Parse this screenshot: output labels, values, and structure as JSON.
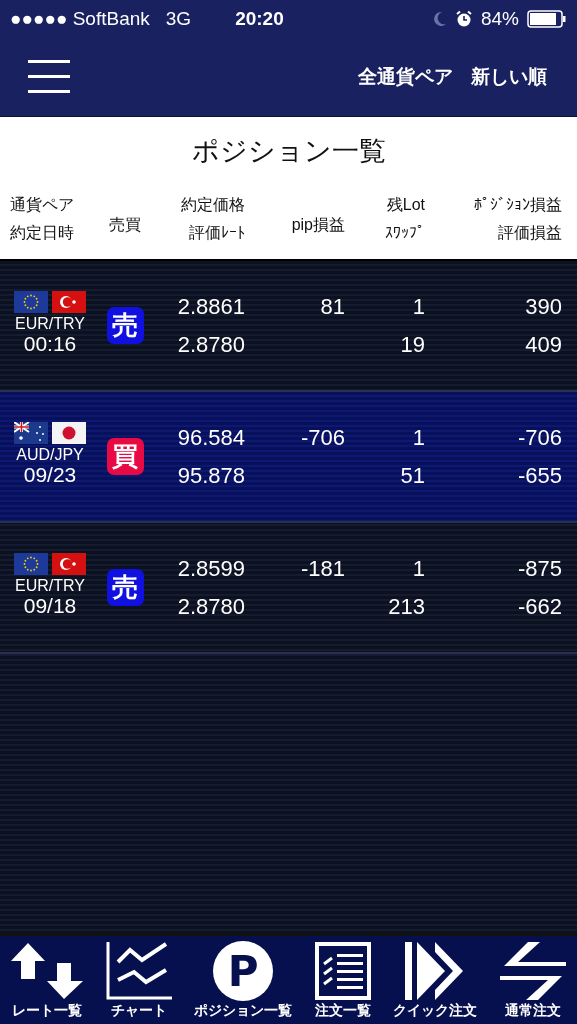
{
  "status_bar": {
    "carrier": "●●●●● SoftBank",
    "network": "3G",
    "time": "20:20",
    "battery": "84%"
  },
  "nav": {
    "filter": "全通貨ペア",
    "sort": "新しい順"
  },
  "title": "ポジション一覧",
  "columns": [
    {
      "line1": "通貨ペア",
      "line2": "約定日時"
    },
    {
      "line1": "売買"
    },
    {
      "line1": "約定価格",
      "line2": "評価ﾚｰﾄ"
    },
    {
      "line1": "pip損益"
    },
    {
      "line1": "残Lot",
      "line2": "ｽﾜｯﾌﾟ"
    },
    {
      "line1": "ﾎﾟｼﾞｼｮﾝ損益",
      "line2": "評価損益"
    }
  ],
  "rows": [
    {
      "flags": [
        {
          "kind": "eu"
        },
        {
          "kind": "tr"
        }
      ],
      "pair": "EUR/TRY",
      "date": "00:16",
      "side": {
        "kind": "sell",
        "label": "売"
      },
      "price": "2.8861",
      "rate": "2.8780",
      "pip": "81",
      "lot": "1",
      "swap": "19",
      "position_pl": "390",
      "eval_pl": "409",
      "selected": false
    },
    {
      "flags": [
        {
          "kind": "au"
        },
        {
          "kind": "jp"
        }
      ],
      "pair": "AUD/JPY",
      "date": "09/23",
      "side": {
        "kind": "buy",
        "label": "買"
      },
      "price": "96.584",
      "rate": "95.878",
      "pip": "-706",
      "lot": "1",
      "swap": "51",
      "position_pl": "-706",
      "eval_pl": "-655",
      "selected": true
    },
    {
      "flags": [
        {
          "kind": "eu"
        },
        {
          "kind": "tr"
        }
      ],
      "pair": "EUR/TRY",
      "date": "09/18",
      "side": {
        "kind": "sell",
        "label": "売"
      },
      "price": "2.8599",
      "rate": "2.8780",
      "pip": "-181",
      "lot": "1",
      "swap": "213",
      "position_pl": "-875",
      "eval_pl": "-662",
      "selected": false
    }
  ],
  "tabs": [
    {
      "kind": "rates",
      "label": "レート一覧"
    },
    {
      "kind": "chart",
      "label": "チャート"
    },
    {
      "kind": "position",
      "label": "ポジション一覧",
      "glyph": "P"
    },
    {
      "kind": "orders",
      "label": "注文一覧"
    },
    {
      "kind": "quick",
      "label": "クイック注文"
    },
    {
      "kind": "normal",
      "label": "通常注文"
    }
  ]
}
